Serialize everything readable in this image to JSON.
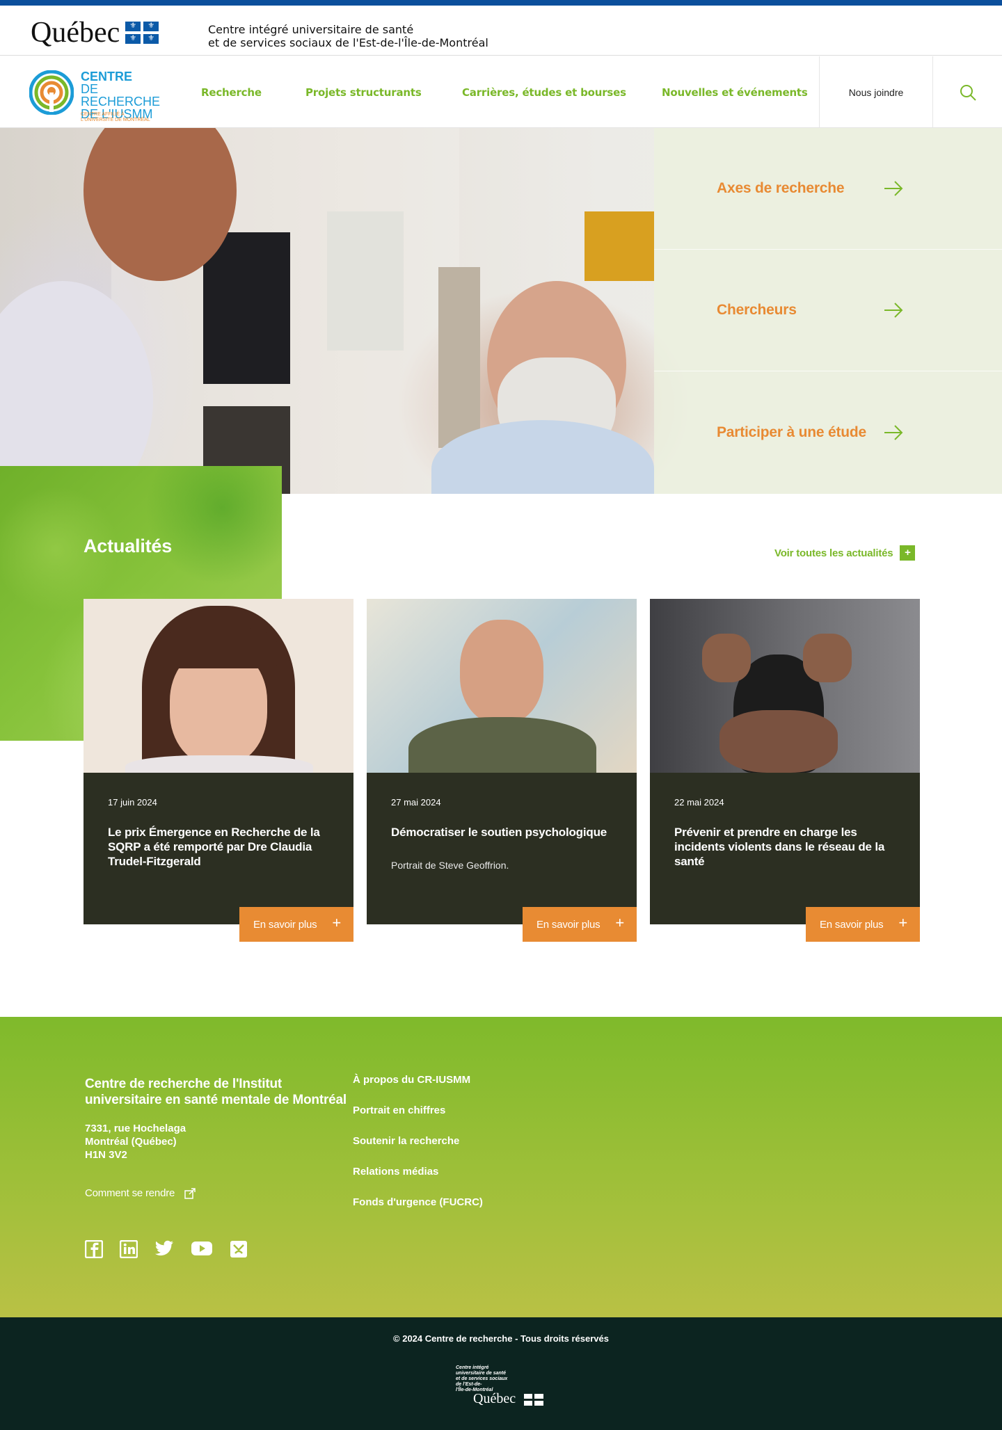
{
  "gov_header": {
    "logo_word": "Québec",
    "org_line1": "Centre intégré universitaire de santé",
    "org_line2": "et de services sociaux de l'Est-de-l'Île-de-Montréal"
  },
  "brand": {
    "line1": "CENTRE",
    "line2": "DE RECHERCHE",
    "line3": "DE L'IUSMM",
    "tagline1": "CENTRE AFFILIÉ À",
    "tagline2": "L'UNIVERSITÉ DE MONTRÉAL"
  },
  "nav": {
    "items": [
      {
        "label": "Recherche"
      },
      {
        "label": "Projets structurants"
      },
      {
        "label": "Carrières, études et bourses"
      },
      {
        "label": "Nouvelles et événements"
      }
    ],
    "join_label": "Nous joindre",
    "search_icon": "search-icon"
  },
  "hero": {
    "links": [
      {
        "label": "Axes de recherche"
      },
      {
        "label": "Chercheurs"
      },
      {
        "label": "Participer à une étude"
      }
    ]
  },
  "news": {
    "title": "Actualités",
    "all_label": "Voir toutes les actualités",
    "all_icon": "+",
    "cards": [
      {
        "date": "17 juin 2024",
        "title": "Le prix Émergence en Recherche de la SQRP a été remporté par Dre Claudia Trudel-Fitzgerald",
        "description": "",
        "more": "En savoir plus"
      },
      {
        "date": "27 mai 2024",
        "title": "Démocratiser le soutien psychologique",
        "description": "Portrait de Steve Geoffrion.",
        "more": "En savoir plus"
      },
      {
        "date": "22 mai 2024",
        "title": "Prévenir et prendre en charge les incidents violents dans le réseau de la santé",
        "description": "",
        "more": "En savoir plus"
      }
    ]
  },
  "footer": {
    "org_name": "Centre de recherche de l'Institut universitaire en santé mentale de Montréal",
    "address_line1": "7331, rue Hochelaga",
    "address_line2": "Montréal (Québec)",
    "address_line3": "H1N 3V2",
    "directions_label": "Comment se rendre",
    "links": [
      {
        "label": "À propos du CR-IUSMM"
      },
      {
        "label": "Portrait en chiffres"
      },
      {
        "label": "Soutenir la recherche"
      },
      {
        "label": "Relations médias"
      },
      {
        "label": "Fonds d'urgence (FUCRC)"
      }
    ],
    "social": [
      "facebook-icon",
      "linkedin-icon",
      "twitter-icon",
      "youtube-icon",
      "other-social-icon"
    ],
    "copyright": "© 2024 Centre de recherche - Tous droits réservés",
    "ciusss_line1": "Centre intégré",
    "ciusss_line2": "universitaire de santé",
    "ciusss_line3": "et de services sociaux",
    "ciusss_line4": "de l'Est-de-",
    "ciusss_line5": "l'Île-de-Montréal",
    "quebec_word": "Québec"
  },
  "colors": {
    "accent_green": "#7ab829",
    "accent_orange": "#e88b33",
    "gov_blue": "#0b4f9c",
    "card_dark": "#2c2f22",
    "footer_dark": "#0c2420"
  }
}
